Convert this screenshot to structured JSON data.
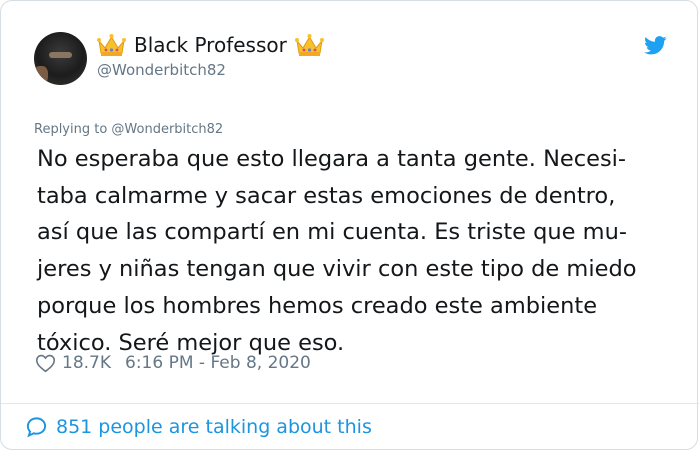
{
  "author": {
    "name": "Black Professor",
    "handle": "@Wonderbitch82"
  },
  "reply": {
    "text": "Replying to @Wonderbitch82"
  },
  "tweet": {
    "lines": [
      "No esperaba que esto llegara a tanta gente. Necesi-",
      "taba calmarme y sacar estas emociones de dentro,",
      "así que las compartí en mi cuenta. Es triste que mu-",
      "jeres y niñas tengan que vivir con este tipo de miedo",
      "porque los hombres hemos creado este ambiente",
      "tóxico. Seré mejor que eso."
    ]
  },
  "meta": {
    "likes": "18.7K",
    "timestamp": "6:16 PM - Feb 8, 2020"
  },
  "footer": {
    "talking": "851 people are talking about this"
  },
  "colors": {
    "accent": "#1b95e0",
    "muted": "#657786",
    "text": "#14171a"
  },
  "icons": [
    "crown-emoji-icon",
    "twitter-bird-icon",
    "heart-icon",
    "chat-bubble-icon"
  ]
}
